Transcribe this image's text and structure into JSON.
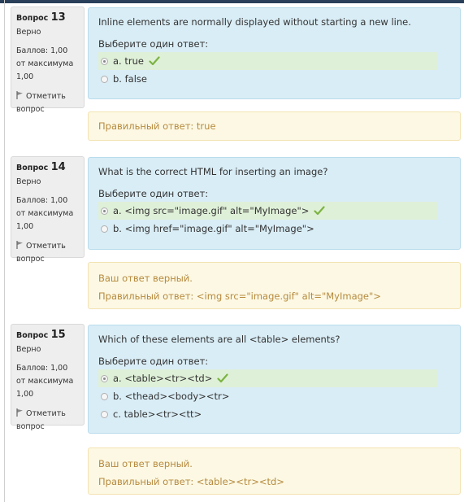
{
  "colors": {
    "question_bg": "#d9edf6",
    "feedback_bg": "#fcf8e3",
    "feedback_text": "#b68a3e",
    "correct_bg": "#dff0d8",
    "check_color": "#7cb342",
    "info_bg": "#eeeeee"
  },
  "questions": [
    {
      "label": "Вопрос",
      "number": "13",
      "state": "Верно",
      "grade": "Баллов: 1,00 от максимума 1,00",
      "flag_label": "Отметить вопрос",
      "text": "Inline elements are normally displayed without starting a new line.",
      "prompt": "Выберите один ответ:",
      "options": [
        {
          "label": "a. true",
          "selected": true,
          "correct": true
        },
        {
          "label": "b. false",
          "selected": false,
          "correct": false
        }
      ],
      "feedback_lines": [
        "Правильный ответ: true"
      ]
    },
    {
      "label": "Вопрос",
      "number": "14",
      "state": "Верно",
      "grade": "Баллов: 1,00 от максимума 1,00",
      "flag_label": "Отметить вопрос",
      "text": "What is the correct HTML for inserting an image?",
      "prompt": "Выберите один ответ:",
      "options": [
        {
          "label": "a. <img src=\"image.gif\" alt=\"MyImage\">",
          "selected": true,
          "correct": true
        },
        {
          "label": "b. <img href=\"image.gif\" alt=\"MyImage\">",
          "selected": false,
          "correct": false
        }
      ],
      "feedback_lines": [
        "Ваш ответ верный.",
        "Правильный ответ: <img src=\"image.gif\" alt=\"MyImage\">"
      ]
    },
    {
      "label": "Вопрос",
      "number": "15",
      "state": "Верно",
      "grade": "Баллов: 1,00 от максимума 1,00",
      "flag_label": "Отметить вопрос",
      "text": "Which of these elements are all <table> elements?",
      "prompt": "Выберите один ответ:",
      "options": [
        {
          "label": "a. <table><tr><td>",
          "selected": true,
          "correct": true
        },
        {
          "label": "b. <thead><body><tr>",
          "selected": false,
          "correct": false
        },
        {
          "label": "c. table><tr><tt>",
          "selected": false,
          "correct": false
        }
      ],
      "feedback_lines": [
        "Ваш ответ верный.",
        "Правильный ответ: <table><tr><td>"
      ]
    }
  ]
}
